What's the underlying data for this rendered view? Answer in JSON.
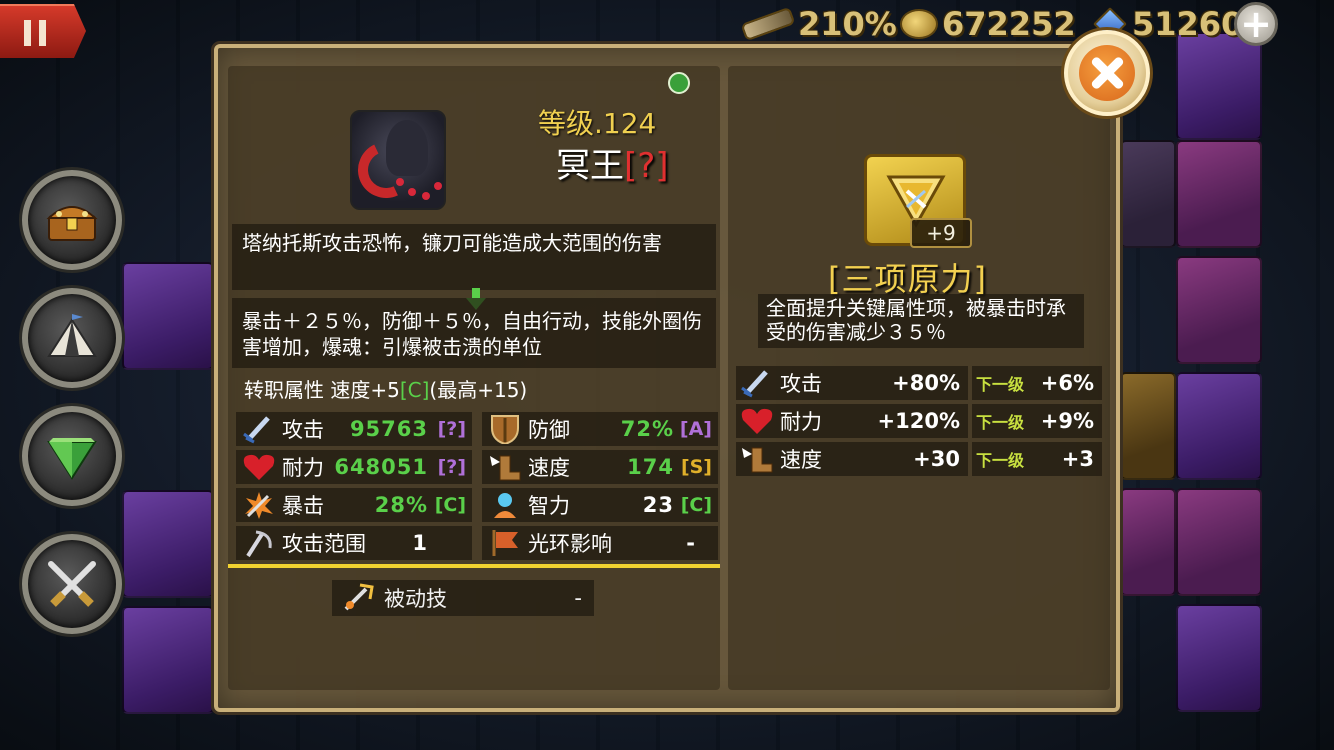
{
  "hud": {
    "pct": "210%",
    "gold": "672252",
    "gems": "51260"
  },
  "hero": {
    "level": "等级.124",
    "name": "冥王",
    "name_tag": "[?]",
    "description": "塔纳托斯攻击恐怖，镰刀可能造成大范围的伤害",
    "traits": "暴击＋２５％，防御＋５％，自由行动，技能外圈伤害增加，爆魂：引爆被击溃的单位",
    "job_prefix": "转职属性 速度+5",
    "job_grade": "[C]",
    "job_suffix": "(最高+15)"
  },
  "stats": {
    "attack": {
      "label": "攻击",
      "value": "95763",
      "grade": "[?]",
      "icon": "sword-icon"
    },
    "defense": {
      "label": "防御",
      "value": "72%",
      "grade": "[A]",
      "icon": "shield-icon"
    },
    "stamina": {
      "label": "耐力",
      "value": "648051",
      "grade": "[?]",
      "icon": "heart-icon"
    },
    "speed": {
      "label": "速度",
      "value": "174",
      "grade": "[S]",
      "icon": "winged-boot-icon"
    },
    "crit": {
      "label": "暴击",
      "value": "28%",
      "grade": "[C]",
      "icon": "crit-burst-icon"
    },
    "intellect": {
      "label": "智力",
      "value": "23",
      "grade": "[C]",
      "icon": "mind-icon"
    },
    "range": {
      "label": "攻击范围",
      "value": "1",
      "icon": "bow-range-icon"
    },
    "aura": {
      "label": "光环影响",
      "value": "-",
      "icon": "banner-icon"
    }
  },
  "passive": {
    "label": "被动技",
    "value": "-"
  },
  "rune": {
    "level": "+9",
    "name": "[三项原力]",
    "description": "全面提升关键属性项，被暴击时承受的伤害减少３５％",
    "next_label": "下一级",
    "rows": [
      {
        "label": "攻击",
        "value": "+80%",
        "next": "+6%",
        "icon": "sword-icon"
      },
      {
        "label": "耐力",
        "value": "+120%",
        "next": "+9%",
        "icon": "heart-icon"
      },
      {
        "label": "速度",
        "value": "+30",
        "next": "+3",
        "icon": "winged-boot-icon"
      }
    ]
  },
  "colors": {
    "level_text": "#f0d050",
    "grade_green": "#5ad04a",
    "grade_purple": "#b070d8",
    "grade_gold": "#e0b02a",
    "divider": "#f2d230"
  }
}
